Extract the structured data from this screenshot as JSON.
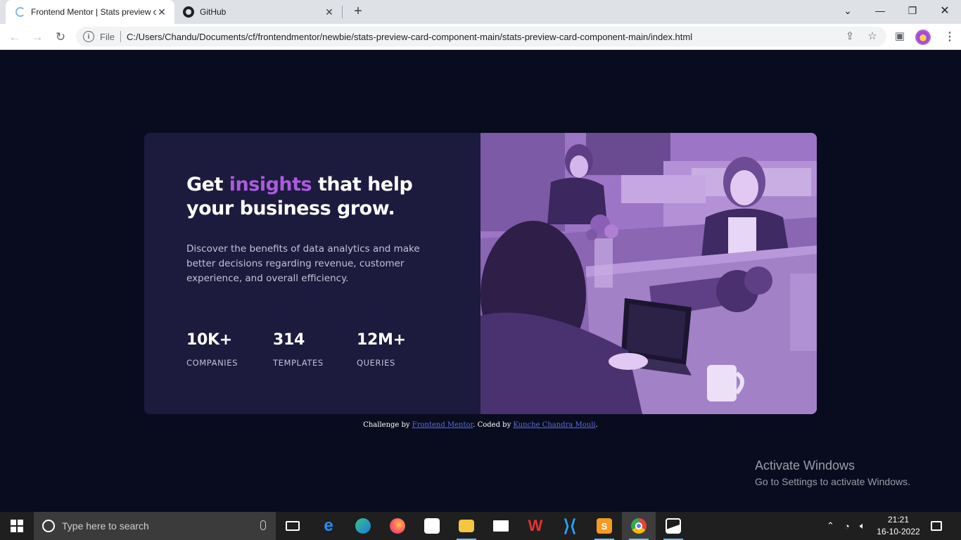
{
  "browser": {
    "tabs": [
      {
        "title": "Frontend Mentor | Stats preview card component",
        "active": true
      },
      {
        "title": "GitHub",
        "active": false
      }
    ],
    "new_tab": "+",
    "address": {
      "scheme_label": "File",
      "url": "C:/Users/Chandu/Documents/cf/frontendmentor/newbie/stats-preview-card-component-main/stats-preview-card-component-main/index.html"
    }
  },
  "card": {
    "headline_pre": "Get ",
    "headline_accent": "insights",
    "headline_post": " that help your business grow.",
    "description": "Discover the benefits of data analytics and make better decisions regarding revenue, customer experience, and overall efficiency.",
    "stats": [
      {
        "value": "10K+",
        "label": "COMPANIES"
      },
      {
        "value": "314",
        "label": "TEMPLATES"
      },
      {
        "value": "12M+",
        "label": "QUERIES"
      }
    ],
    "accent_color": "#aa5cdb",
    "image_overlay_color": "#9d75c7"
  },
  "attribution": {
    "prefix": "Challenge by ",
    "link1": "Frontend Mentor",
    "middle": ". Coded by ",
    "link2": "Kunche Chandra Mouli",
    "suffix": "."
  },
  "watermark": {
    "title": "Activate Windows",
    "subtitle": "Go to Settings to activate Windows."
  },
  "taskbar": {
    "search_placeholder": "Type here to search",
    "time": "21:21",
    "date": "16-10-2022",
    "apps": [
      "task-view",
      "edge-legacy",
      "edge",
      "firefox",
      "store",
      "file-explorer",
      "mail",
      "wps",
      "vscode",
      "sublime",
      "chrome",
      "photos"
    ]
  }
}
